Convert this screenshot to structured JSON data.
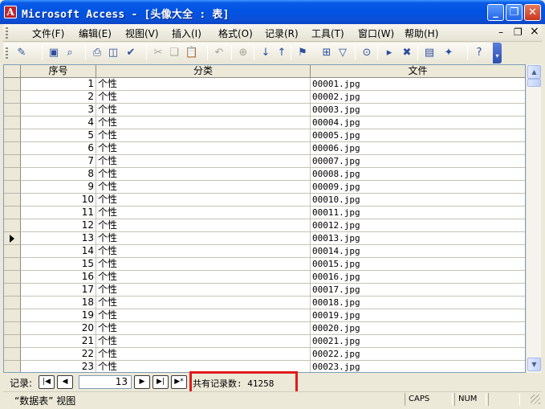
{
  "window": {
    "app_icon_glyph": "A",
    "title": "Microsoft Access - [头像大全 : 表]",
    "minimize_glyph": "_",
    "restore_glyph": "❐",
    "close_glyph": "✕"
  },
  "menubar": {
    "items": [
      {
        "label": "文件(F)"
      },
      {
        "label": "编辑(E)"
      },
      {
        "label": "视图(V)"
      },
      {
        "label": "插入(I)"
      },
      {
        "label": "格式(O)"
      },
      {
        "label": "记录(R)"
      },
      {
        "label": "工具(T)"
      },
      {
        "label": "窗口(W)"
      },
      {
        "label": "帮助(H)"
      }
    ],
    "doc_min": "–",
    "doc_restore": "❐",
    "doc_close": "×"
  },
  "toolbar": {
    "icons": [
      {
        "name": "view-design-icon",
        "glyph": "✎"
      },
      {
        "name": "save-icon",
        "glyph": "▣"
      },
      {
        "name": "search-file-icon",
        "glyph": "⌕"
      },
      {
        "name": "print-icon",
        "glyph": "⎙"
      },
      {
        "name": "print-preview-icon",
        "glyph": "◫"
      },
      {
        "name": "spelling-icon",
        "glyph": "✔"
      },
      {
        "name": "cut-icon",
        "glyph": "✂"
      },
      {
        "name": "copy-icon",
        "glyph": "❏"
      },
      {
        "name": "paste-icon",
        "glyph": "📋"
      },
      {
        "name": "undo-icon",
        "glyph": "↶"
      },
      {
        "name": "hyperlink-icon",
        "glyph": "⊕"
      },
      {
        "name": "sort-ascending-icon",
        "glyph": "↓"
      },
      {
        "name": "sort-descending-icon",
        "glyph": "↑"
      },
      {
        "name": "filter-selection-icon",
        "glyph": "⚑"
      },
      {
        "name": "filter-form-icon",
        "glyph": "⊞"
      },
      {
        "name": "apply-filter-icon",
        "glyph": "▽"
      },
      {
        "name": "find-icon",
        "glyph": "⊙"
      },
      {
        "name": "new-record-icon",
        "glyph": "▸"
      },
      {
        "name": "delete-record-icon",
        "glyph": "✖"
      },
      {
        "name": "database-window-icon",
        "glyph": "▤"
      },
      {
        "name": "new-object-icon",
        "glyph": "✦"
      },
      {
        "name": "help-icon",
        "glyph": "?"
      }
    ]
  },
  "table": {
    "columns": [
      "序号",
      "分类",
      "文件"
    ],
    "rows": [
      {
        "id": "1",
        "category": "个性",
        "file": "00001.jpg"
      },
      {
        "id": "2",
        "category": "个性",
        "file": "00002.jpg"
      },
      {
        "id": "3",
        "category": "个性",
        "file": "00003.jpg"
      },
      {
        "id": "4",
        "category": "个性",
        "file": "00004.jpg"
      },
      {
        "id": "5",
        "category": "个性",
        "file": "00005.jpg"
      },
      {
        "id": "6",
        "category": "个性",
        "file": "00006.jpg"
      },
      {
        "id": "7",
        "category": "个性",
        "file": "00007.jpg"
      },
      {
        "id": "8",
        "category": "个性",
        "file": "00008.jpg"
      },
      {
        "id": "9",
        "category": "个性",
        "file": "00009.jpg"
      },
      {
        "id": "10",
        "category": "个性",
        "file": "00010.jpg"
      },
      {
        "id": "11",
        "category": "个性",
        "file": "00011.jpg"
      },
      {
        "id": "12",
        "category": "个性",
        "file": "00012.jpg"
      },
      {
        "id": "13",
        "category": "个性",
        "file": "00013.jpg"
      },
      {
        "id": "14",
        "category": "个性",
        "file": "00014.jpg"
      },
      {
        "id": "15",
        "category": "个性",
        "file": "00015.jpg"
      },
      {
        "id": "16",
        "category": "个性",
        "file": "00016.jpg"
      },
      {
        "id": "17",
        "category": "个性",
        "file": "00017.jpg"
      },
      {
        "id": "18",
        "category": "个性",
        "file": "00018.jpg"
      },
      {
        "id": "19",
        "category": "个性",
        "file": "00019.jpg"
      },
      {
        "id": "20",
        "category": "个性",
        "file": "00020.jpg"
      },
      {
        "id": "21",
        "category": "个性",
        "file": "00021.jpg"
      },
      {
        "id": "22",
        "category": "个性",
        "file": "00022.jpg"
      },
      {
        "id": "23",
        "category": "个性",
        "file": "00023.jpg"
      }
    ],
    "current_row": 13
  },
  "navigation": {
    "label": "记录:",
    "first_glyph": "|◀",
    "prev_glyph": "◀",
    "current_record": "13",
    "next_glyph": "▶",
    "last_glyph": "▶|",
    "new_glyph": "▶*",
    "total_text": "共有记录数: 41258"
  },
  "statusbar": {
    "view_text": "“数据表” 视图",
    "caps": "CAPS",
    "num": "NUM"
  },
  "scrollbar": {
    "up_glyph": "▲",
    "down_glyph": "▼"
  }
}
